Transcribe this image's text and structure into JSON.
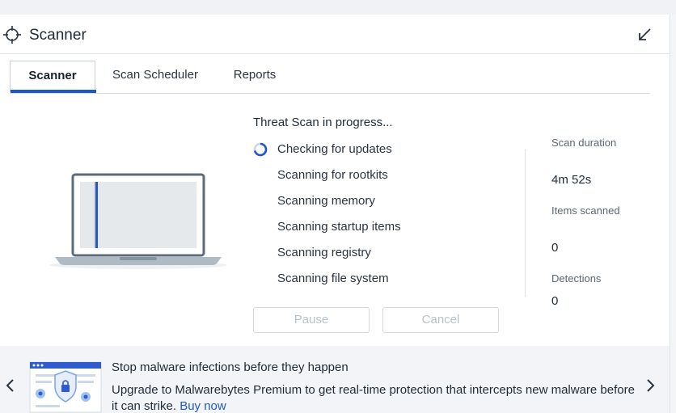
{
  "header": {
    "title": "Scanner",
    "icon": "crosshair-icon",
    "collapse_icon": "collapse-arrow-icon"
  },
  "tabs": [
    {
      "label": "Scanner",
      "active": true
    },
    {
      "label": "Scan Scheduler",
      "active": false
    },
    {
      "label": "Reports",
      "active": false
    }
  ],
  "scan": {
    "title": "Threat Scan in progress...",
    "steps": [
      {
        "label": "Checking for updates",
        "status": "in-progress"
      },
      {
        "label": "Scanning for rootkits",
        "status": "pending"
      },
      {
        "label": "Scanning memory",
        "status": "pending"
      },
      {
        "label": "Scanning startup items",
        "status": "pending"
      },
      {
        "label": "Scanning registry",
        "status": "pending"
      },
      {
        "label": "Scanning file system",
        "status": "pending"
      }
    ],
    "pause_label": "Pause",
    "cancel_label": "Cancel"
  },
  "stats": {
    "duration_label": "Scan duration",
    "duration_value": "4m 52s",
    "items_label": "Items scanned",
    "items_value": "0",
    "detections_label": "Detections",
    "detections_value": "0"
  },
  "promo": {
    "title": "Stop malware infections before they happen",
    "body": "Upgrade to Malwarebytes Premium to get real-time protection that intercepts new malware before it can strike.",
    "link": "Buy now"
  },
  "colors": {
    "accent": "#1f57c6",
    "text": "#1f2a37",
    "muted": "#5b6572",
    "disabled": "#b8c0c9",
    "banner_bg": "#f2f4f7"
  }
}
